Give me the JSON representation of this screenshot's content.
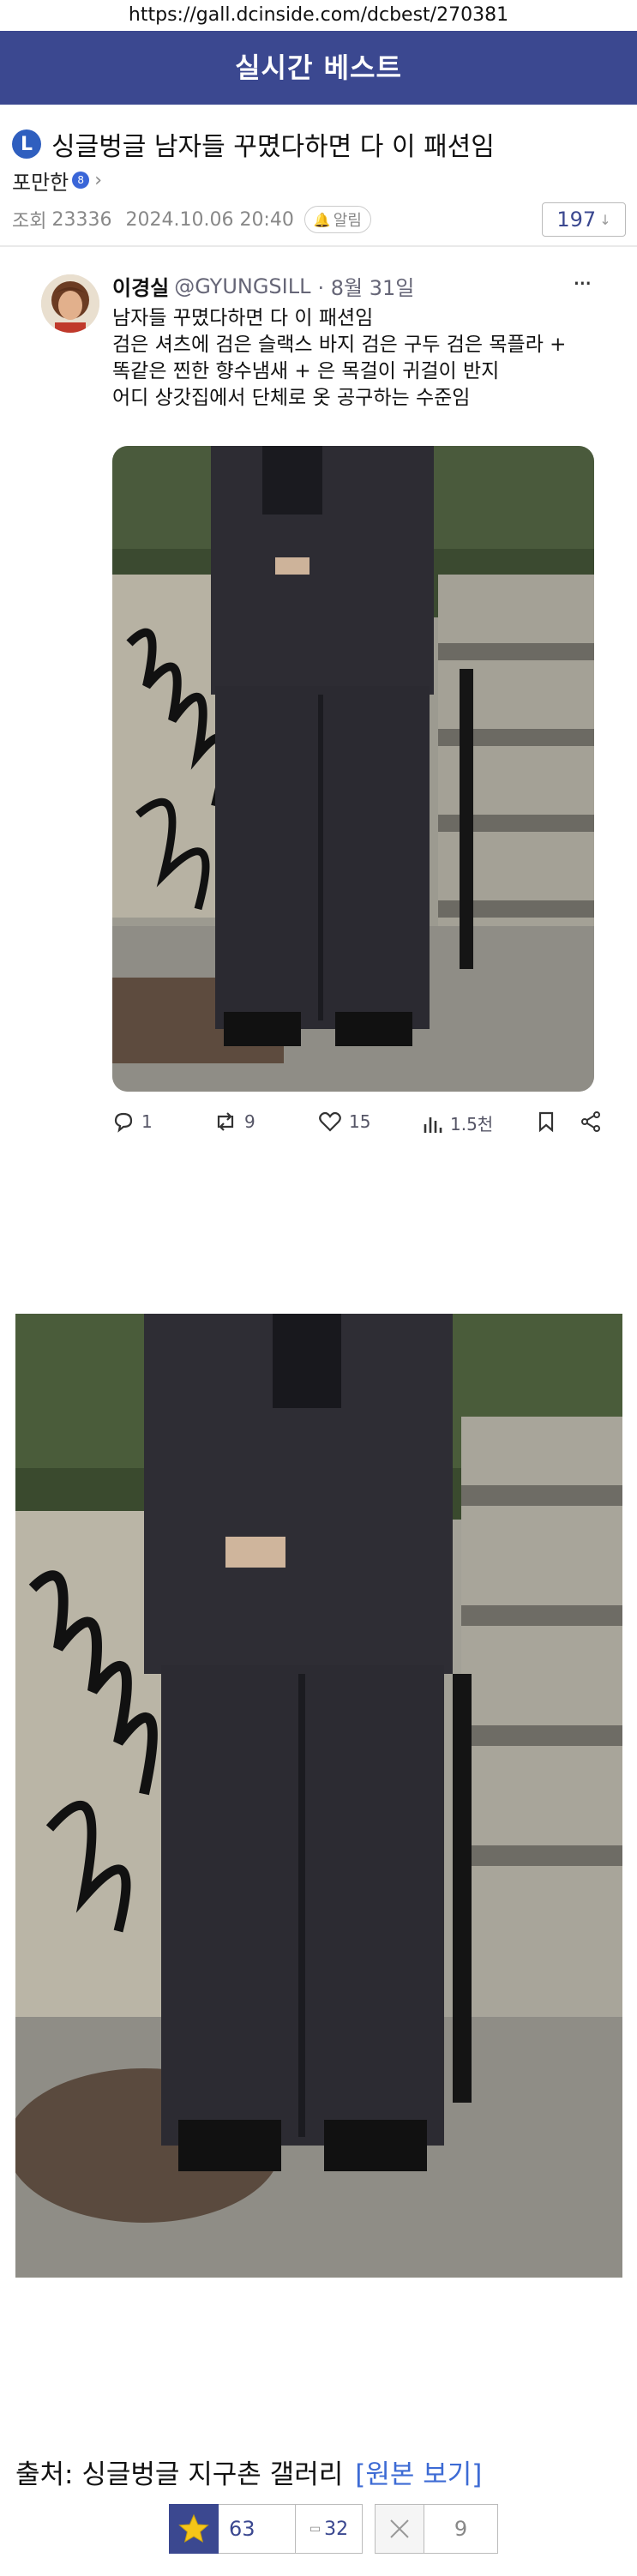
{
  "browser": {
    "url": "https://gall.dcinside.com/dcbest/270381"
  },
  "header": {
    "title": "실시간 베스트"
  },
  "post": {
    "badge": "L",
    "title": "싱글벙글 남자들 꾸몄다하면 다 이 패션임",
    "author": "포만한",
    "author_badge": "8",
    "author_chevron": "›",
    "views_label": "조회",
    "views": "23336",
    "datetime": "2024.10.06 20:40",
    "alarm_label": "알림",
    "comment_count": "197",
    "comment_arrow": "↓"
  },
  "tweet": {
    "name": "이경실",
    "handle": "@GYUNGSILL",
    "date": "· 8월 31일",
    "more": "···",
    "lines": [
      "남자들 꾸몄다하면 다 이 패션임",
      "검은 셔츠에 검은 슬랙스 바지 검은 구두 검은 목플라 +",
      "똑같은 찐한 향수냄새 + 은 목걸이 귀걸이 반지",
      "어디 상갓집에서 단체로 옷 공구하는 수준임"
    ],
    "actions": {
      "replies": "1",
      "retweets": "9",
      "likes": "15",
      "views": "1.5천"
    }
  },
  "source": {
    "label": "출처: 싱글벙글 지구촌 갤러리",
    "link": "[원본 보기]"
  },
  "votes": {
    "up": "63",
    "fixed": "32",
    "fixed_icon": "▭",
    "down": "9"
  },
  "colors": {
    "brand": "#3b4890",
    "link": "#3d6bd4",
    "star": "#f5c518"
  },
  "icons": [
    "reply-icon",
    "retweet-icon",
    "heart-icon",
    "views-icon",
    "bookmark-icon",
    "share-icon",
    "star-icon",
    "x-icon",
    "bell-icon"
  ]
}
